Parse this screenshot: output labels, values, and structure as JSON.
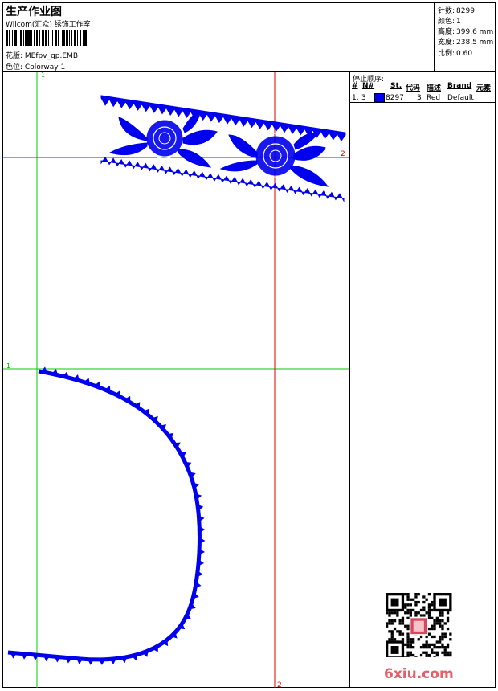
{
  "header": {
    "title": "生产作业图",
    "company": "Wilcom(汇众) 绣饰工作室",
    "design_label": "花版:",
    "design_value": "MEfpv_gp.EMB",
    "colorway_label": "色位:",
    "colorway_value": "Colorway 1"
  },
  "stats": [
    {
      "label": "针数:",
      "value": "8299"
    },
    {
      "label": "颜色:",
      "value": "1"
    },
    {
      "label": "高度:",
      "value": "399.6 mm"
    },
    {
      "label": "宽度:",
      "value": "238.5 mm"
    },
    {
      "label": "比例:",
      "value": "0.60"
    }
  ],
  "stop_sequence": {
    "title": "停止顺序:",
    "columns": [
      "#",
      "N#",
      "St.",
      "代码",
      "描述",
      "Brand",
      "元素"
    ],
    "rows": [
      {
        "num": "1.",
        "n": "3",
        "stitches": "8297",
        "code": "3",
        "description": "Red",
        "brand": "Default",
        "color": "#0000ee"
      }
    ]
  },
  "guides": {
    "top_green": "1",
    "top_red": "2",
    "bottom_green": "1",
    "bottom_red": "2"
  },
  "colors": {
    "stitch": "#0000ee",
    "guide_green": "#00cc00",
    "guide_red": "#dd0000",
    "watermark": "#e2606a"
  },
  "watermark": "6xiu.com"
}
